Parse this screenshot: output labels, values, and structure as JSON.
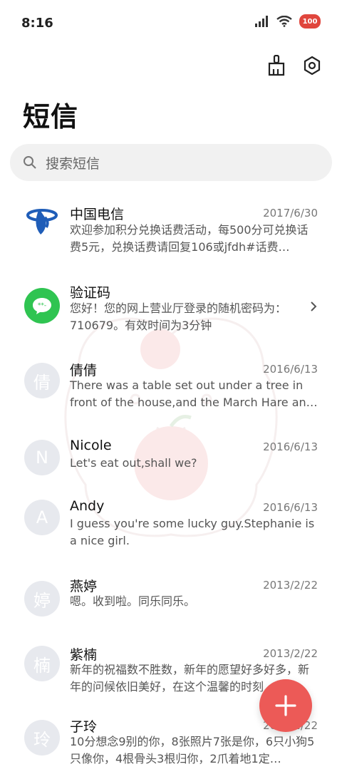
{
  "status": {
    "time": "8:16",
    "battery": "100"
  },
  "header": {
    "title": "短信"
  },
  "search": {
    "placeholder": "搜索短信"
  },
  "conversations": [
    {
      "avatar": "",
      "name": "中国电信",
      "date": "2017/6/30",
      "preview": "欢迎参加积分兑换话费活动，每500分可兑换话费5元，兑换话费请回复106或jfdh#话费…",
      "avatar_type": "logo-telecom"
    },
    {
      "avatar": "",
      "name": "验证码",
      "date": "",
      "preview": "您好！您的网上营业厅登录的随机密码为：710679。有效时间为3分钟",
      "avatar_type": "message-bubble",
      "has_chevron": true
    },
    {
      "avatar": "倩",
      "name": "倩倩",
      "date": "2016/6/13",
      "preview": "There was a table set out under a tree in front of the house,and the March Hare an…"
    },
    {
      "avatar": "N",
      "name": "Nicole",
      "date": "2016/6/13",
      "preview": "Let's eat out,shall we?"
    },
    {
      "avatar": "A",
      "name": "Andy",
      "date": "2016/6/13",
      "preview": "I guess you're some lucky guy.Stephanie is a nice girl."
    },
    {
      "avatar": "婷",
      "name": "燕婷",
      "date": "2013/2/22",
      "preview": "嗯。收到啦。同乐同乐。"
    },
    {
      "avatar": "楠",
      "name": "紫楠",
      "date": "2013/2/22",
      "preview": "新年的祝福数不胜数，新年的愿望好多好多，新年的问候依旧美好，在这个温馨的时刻…"
    },
    {
      "avatar": "玲",
      "name": "子玲",
      "date": "2013/2/22",
      "preview": "10分想念9别的你，8张照片7张是你，6只小狗5只像你，4根骨头3根归你，2爪着地1定…"
    }
  ],
  "colors": {
    "accent": "#ec5a57",
    "telecom_blue": "#1f5db8",
    "message_green": "#2fc451",
    "avatar_bg": "#e7e9ee"
  }
}
